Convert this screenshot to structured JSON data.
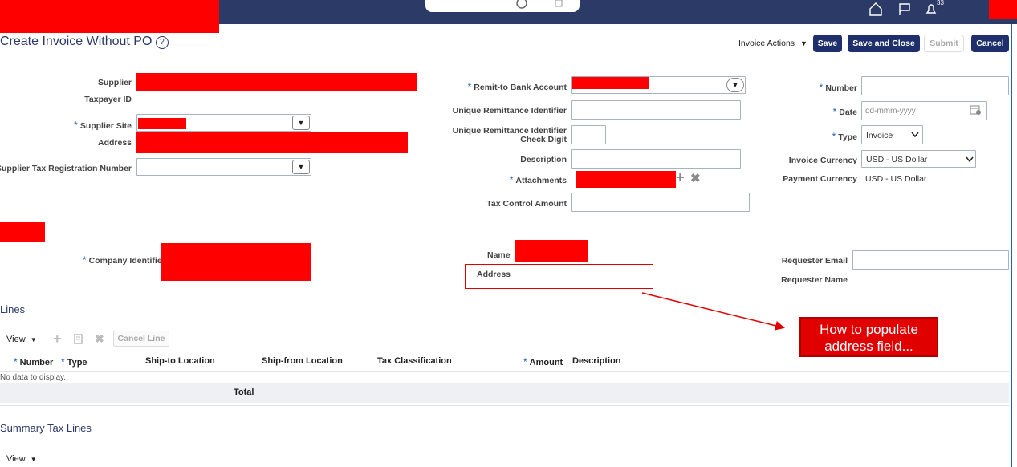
{
  "header": {
    "title": "Create Invoice Without PO",
    "notifications_count": "33",
    "help_glyph": "?"
  },
  "toolbar": {
    "invoice_actions": "Invoice Actions",
    "save": "Save",
    "save_and_close": "Save and Close",
    "submit": "Submit",
    "cancel": "Cancel"
  },
  "supplier_section": {
    "supplier_label": "Supplier",
    "taxpayer_id_label": "Taxpayer ID",
    "supplier_site_label": "Supplier Site",
    "address_label": "Address",
    "tax_reg_label": "Supplier Tax Registration Number"
  },
  "bank_section": {
    "remit_label": "Remit-to Bank Account",
    "uri_label": "Unique Remittance Identifier",
    "uri_check_label_1": "Unique Remittance Identifier",
    "uri_check_label_2": "Check Digit",
    "description_label": "Description",
    "attachments_label": "Attachments",
    "tax_control_label": "Tax Control Amount"
  },
  "invoice_section": {
    "number_label": "Number",
    "date_label": "Date",
    "date_placeholder": "dd-mmm-yyyy",
    "type_label": "Type",
    "type_value": "Invoice",
    "currency_label": "Invoice Currency",
    "currency_value": "USD - US Dollar",
    "payment_currency_label": "Payment Currency",
    "payment_currency_value": "USD - US Dollar"
  },
  "company_section": {
    "company_identifier_label": "Company Identifie",
    "name_label": "Name",
    "address_label": "Address",
    "requester_email_label": "Requester Email",
    "requester_name_label": "Requester Name"
  },
  "lines": {
    "title": "Lines",
    "view_label": "View",
    "cancel_line": "Cancel Line",
    "columns": [
      "Number",
      "Type",
      "Ship-to Location",
      "Ship-from Location",
      "Tax Classification",
      "Amount",
      "Description"
    ],
    "no_data": "No data to display.",
    "total_label": "Total"
  },
  "summary_tax": {
    "title": "Summary Tax Lines",
    "view_label": "View"
  },
  "annotation": {
    "text_line1": "How to populate",
    "text_line2": "address field..."
  },
  "colors": {
    "topbar": "#2b3a67",
    "redaction": "#ff0000",
    "primary_button": "#1f2f6b",
    "annotation": "#e00000"
  }
}
